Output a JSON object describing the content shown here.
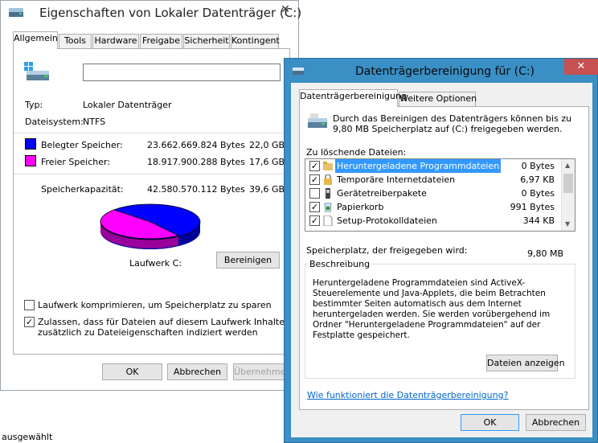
{
  "props_window": {
    "title": "Eigenschaften von Lokaler Datenträger (C:)",
    "close": "✕",
    "tabs": [
      "Allgemein",
      "Tools",
      "Hardware",
      "Freigabe",
      "Sicherheit",
      "Kontingent"
    ],
    "name_value": "",
    "type_label": "Typ:",
    "type_value": "Lokaler Datenträger",
    "fs_label": "Dateisystem:",
    "fs_value": "NTFS",
    "used_label": "Belegter Speicher:",
    "used_bytes": "23.662.669.824 Bytes",
    "used_gb": "22,0 GB",
    "free_label": "Freier Speicher:",
    "free_bytes": "18.917.900.288 Bytes",
    "free_gb": "17,6 GB",
    "cap_label": "Speicherkapazität:",
    "cap_bytes": "42.580.570.112 Bytes",
    "cap_gb": "39,6 GB",
    "used_color": "#0000ff",
    "free_color": "#ff00ff",
    "drive_label": "Laufwerk C:",
    "cleanup_button": "Bereinigen",
    "compress_label": "Laufwerk komprimieren, um Speicherplatz zu sparen",
    "compress_checked": false,
    "index_label_1": "Zulassen, dass für Dateien auf diesem Laufwerk Inhalte",
    "index_label_2": "zusätzlich zu Dateieigenschaften indiziert werden",
    "index_checked": true,
    "ok": "OK",
    "cancel": "Abbrechen",
    "apply": "Übernehmen"
  },
  "status_text": "ausgewählt",
  "cleanup": {
    "title": "Datenträgerbereinigung für  (C:)",
    "close": "✕",
    "tabs": [
      "Datenträgerbereinigung",
      "Weitere Optionen"
    ],
    "intro_1": "Durch das Bereinigen des Datenträgers können bis zu",
    "intro_2": "9,80 MB Speicherplatz auf  (C:) freigegeben werden.",
    "list_label": "Zu löschende Dateien:",
    "files": [
      {
        "name": "Heruntergeladene Programmdateien",
        "size": "0 Bytes",
        "checked": true,
        "selected": true,
        "icon": "folder-icon"
      },
      {
        "name": "Temporäre Internetdateien",
        "size": "6,97 KB",
        "checked": true,
        "selected": false,
        "icon": "lock-icon"
      },
      {
        "name": "Gerätetreiberpakete",
        "size": "0 Bytes",
        "checked": false,
        "selected": false,
        "icon": "driver-icon"
      },
      {
        "name": "Papierkorb",
        "size": "991 Bytes",
        "checked": true,
        "selected": false,
        "icon": "recycle-bin-icon"
      },
      {
        "name": "Setup-Protokolldateien",
        "size": "344 KB",
        "checked": true,
        "selected": false,
        "icon": "document-icon"
      }
    ],
    "space_label": "Speicherplatz, der freigegeben wird:",
    "space_value": "9,80 MB",
    "desc_label": "Beschreibung",
    "desc_text": "Heruntergeladene Programmdateien sind ActiveX-Steuerelemente und Java-Applets, die beim Betrachten bestimmter Seiten automatisch aus dem Internet heruntergeladen werden. Sie werden vorübergehend im Ordner \"Heruntergeladene Programmdateien\" auf der Festplatte gespeichert.",
    "view_files_button": "Dateien anzeigen",
    "help_link": "Wie funktioniert die Datenträgerbereinigung?",
    "ok": "OK",
    "cancel": "Abbrechen"
  }
}
